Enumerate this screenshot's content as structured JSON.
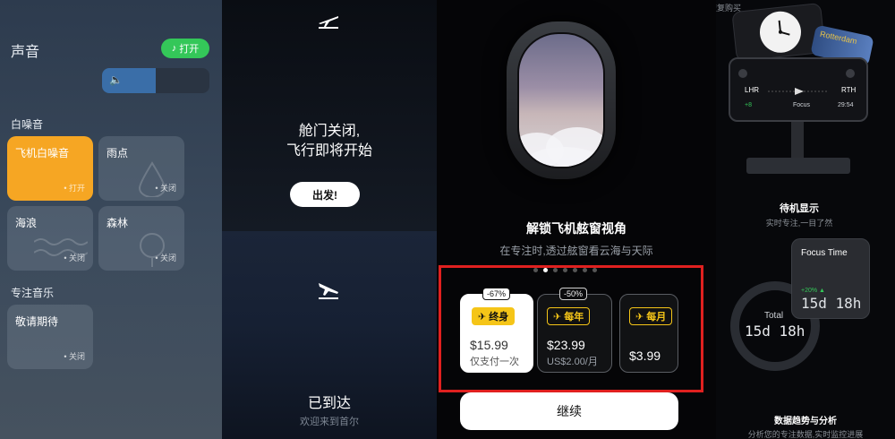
{
  "sound_panel": {
    "title": "声音",
    "toggle_label": "打开",
    "volume_level": 0.5,
    "white_noise_header": "白噪音",
    "tiles": [
      {
        "name": "飞机白噪音",
        "state": "打开",
        "active": true
      },
      {
        "name": "雨点",
        "state": "关闭",
        "active": false
      },
      {
        "name": "海浪",
        "state": "关闭",
        "active": false
      },
      {
        "name": "森林",
        "state": "关闭",
        "active": false
      }
    ],
    "focus_music_header": "专注音乐",
    "music_tile": {
      "name": "敬请期待",
      "state": "关闭"
    }
  },
  "flight_panel": {
    "heading_line1": "舱门关闭,",
    "heading_line2": "飞行即将开始",
    "depart_button": "出发!",
    "arrived_title": "已到达",
    "arrived_sub": "欢迎来到首尔"
  },
  "paywall": {
    "title": "解锁飞机舷窗视角",
    "subtitle": "在专注时,透过舷窗看云海与天际",
    "page_dots": 7,
    "active_dot": 1,
    "plans": [
      {
        "tag": "终身",
        "discount": "-67%",
        "price": "$15.99",
        "note": "仅支付一次",
        "selected": true
      },
      {
        "tag": "每年",
        "discount": "-50%",
        "price": "$23.99",
        "note": "US$2.00/月",
        "selected": false
      },
      {
        "tag": "每月",
        "discount": "",
        "price": "$3.99",
        "note": "",
        "selected": false
      }
    ],
    "continue_button": "继续"
  },
  "features_panel": {
    "restore_purchase": "恢复购买",
    "ticket_text": "Rotterdam",
    "standby_screen": {
      "from": "LHR",
      "to": "RTH",
      "left_value": "+8",
      "mode": "Focus",
      "time": "29:54"
    },
    "standby_title": "待机显示",
    "standby_sub": "实时专注,一目了然",
    "focus_card_title": "Focus Time",
    "focus_card_badge": "+20% ▲",
    "focus_card_value": "15d 18h",
    "total_label": "Total",
    "total_value": "15d 18h",
    "trends_title": "数据趋势与分析",
    "trends_sub": "分析您的专注数据,实时监控进展"
  }
}
